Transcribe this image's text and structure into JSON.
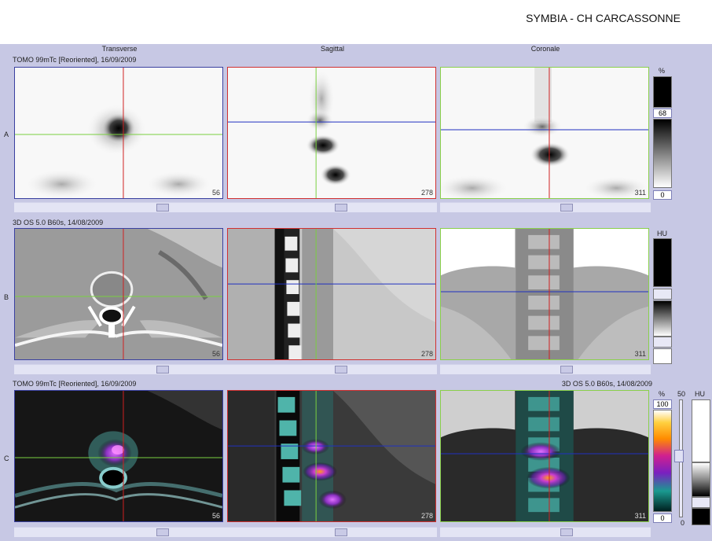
{
  "header": {
    "title": "SYMBIA - CH CARCASSONNE"
  },
  "columns": [
    "Transverse",
    "Sagittal",
    "Coronale"
  ],
  "rows": [
    {
      "letter": "A",
      "series": "TOMO 99mTc [Reoriented], 16/09/2009",
      "slices": [
        "56",
        "278",
        "311"
      ]
    },
    {
      "letter": "B",
      "series": "3D  OS  5.0  B60s, 14/08/2009",
      "slices": [
        "56",
        "278",
        "311"
      ]
    },
    {
      "letter": "C",
      "series": "TOMO 99mTc [Reoriented], 16/09/2009",
      "series_right": "3D  OS  5.0  B60s, 14/08/2009",
      "slices": [
        "56",
        "278",
        "311"
      ]
    }
  ],
  "scales": {
    "a": {
      "unit": "%",
      "max": "68",
      "min": "0"
    },
    "b": {
      "unit": "HU"
    },
    "c": {
      "unit": "%",
      "max": "100",
      "min": "0",
      "mid": "50",
      "unit2": "HU",
      "min2": "0"
    }
  },
  "colors": {
    "workspace": "#c7c8e4",
    "transverse_border": "#3a40a0",
    "sagittal_border": "#d03030",
    "coronal_border": "#8ad04a"
  }
}
